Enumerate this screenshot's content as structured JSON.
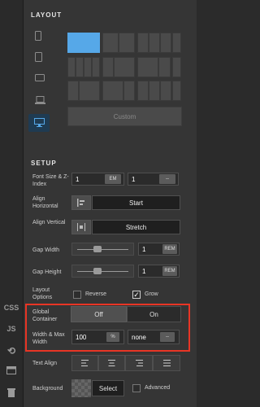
{
  "rail": {
    "css_label": "CSS",
    "js_label": "JS"
  },
  "layout": {
    "title": "LAYOUT",
    "custom_label": "Custom"
  },
  "setup": {
    "title": "SETUP",
    "font_size": {
      "label": "Font Size & Z-Index",
      "value": "1",
      "unit": "EM",
      "z_value": "1",
      "z_unit": "--"
    },
    "align_h": {
      "label": "Align Horizontal",
      "value": "Start"
    },
    "align_v": {
      "label": "Align Vertical",
      "value": "Stretch"
    },
    "gap_width": {
      "label": "Gap Width",
      "value": "1",
      "unit": "REM"
    },
    "gap_height": {
      "label": "Gap Height",
      "value": "1",
      "unit": "REM"
    },
    "layout_options": {
      "label": "Layout Options",
      "reverse": "Reverse",
      "grow": "Grow",
      "reverse_checked": false,
      "grow_checked": true
    },
    "global_container": {
      "label": "Global Container",
      "off": "Off",
      "on": "On",
      "selected": "Off"
    },
    "width_max": {
      "label": "Width & Max Width",
      "value": "100",
      "unit": "%",
      "max_value": "none",
      "max_unit": "--"
    },
    "text_align": {
      "label": "Text Align"
    },
    "background": {
      "label": "Background",
      "select": "Select",
      "advanced": "Advanced"
    }
  },
  "icons": {
    "phone": "phone-icon",
    "tablet": "tablet-icon",
    "tablet_landscape": "tablet-landscape-icon",
    "laptop": "laptop-icon",
    "desktop": "desktop-icon",
    "history": "history-icon",
    "card": "card-icon",
    "trash": "trash-icon"
  },
  "colors": {
    "accent": "#56a8e8",
    "highlight": "#e83525"
  }
}
